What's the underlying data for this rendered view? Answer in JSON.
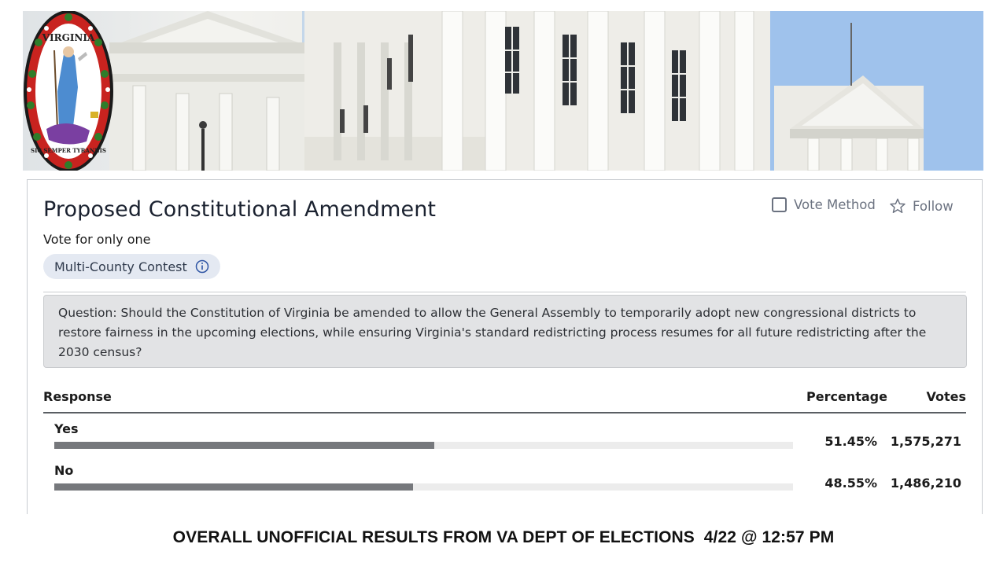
{
  "banner": {
    "seal_text_top": "VIRGINIA",
    "seal_text_bottom": "SIC SEMPER TYRANNIS"
  },
  "contest": {
    "title": "Proposed Constitutional Amendment",
    "vote_for": "Vote for only one",
    "chip_label": "Multi-County Contest",
    "chip_icon": "info-icon",
    "vote_method_label": "Vote Method",
    "follow_label": "Follow",
    "follow_icon": "star-icon",
    "question": "Question: Should the Constitution of Virginia be amended to allow the General Assembly to temporarily adopt new congressional districts to restore fairness in the upcoming elections, while ensuring Virginia's standard redistricting process resumes for all future redistricting after the 2030 census?"
  },
  "results": {
    "headers": {
      "response": "Response",
      "percentage": "Percentage",
      "votes": "Votes"
    },
    "rows": [
      {
        "label": "Yes",
        "percentage": "51.45%",
        "votes": "1,575,271",
        "share": 0.5145
      },
      {
        "label": "No",
        "percentage": "48.55%",
        "votes": "1,486,210",
        "share": 0.4855
      }
    ]
  },
  "footer": {
    "text": "OVERALL UNOFFICIAL RESULTS FROM VA DEPT OF ELECTIONS  4/22 @ 12:57 PM"
  },
  "colors": {
    "bar_fill": "#76787c",
    "bar_track": "#ececec",
    "chip_bg": "#e4e9f2",
    "question_bg": "#e2e3e5"
  }
}
